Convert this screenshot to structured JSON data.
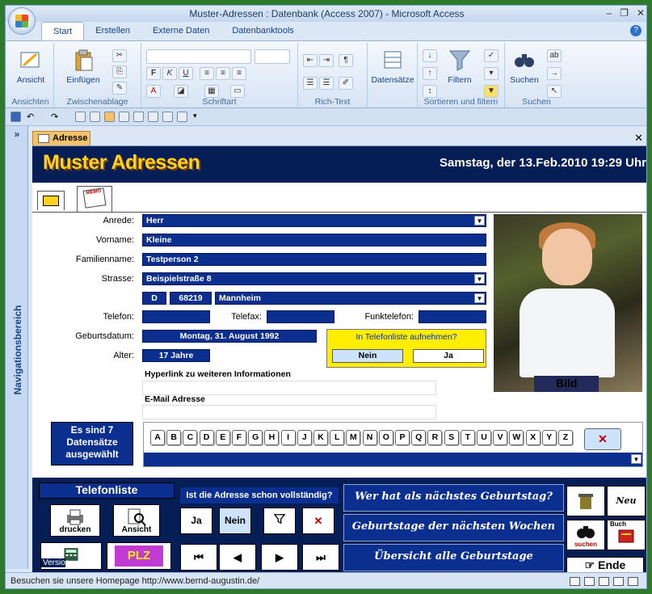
{
  "window": {
    "title": "Muster-Adressen : Datenbank (Access 2007) - Microsoft Access"
  },
  "ribbon": {
    "tabs": [
      "Start",
      "Erstellen",
      "Externe Daten",
      "Datenbanktools"
    ],
    "groups": {
      "ansichten": "Ansichten",
      "zwischenablage": "Zwischenablage",
      "schriftart": "Schriftart",
      "richtext": "Rich-Text",
      "sortieren": "Sortieren und filtern",
      "suchen": "Suchen"
    },
    "buttons": {
      "ansicht": "Ansicht",
      "einfuegen": "Einfügen",
      "datensaetze": "Datensätze",
      "filtern": "Filtern",
      "suchen": "Suchen"
    }
  },
  "nav": {
    "label": "Navigationsbereich"
  },
  "document": {
    "tab": "Adresse"
  },
  "form": {
    "title": "Muster Adressen",
    "datetime": "Samstag, der 13.Feb.2010 19:29 Uhr",
    "labels": {
      "anrede": "Anrede:",
      "vorname": "Vorname:",
      "familienname": "Familienname:",
      "strasse": "Strasse:",
      "telefon": "Telefon:",
      "telefax": "Telefax:",
      "funktelefon": "Funktelefon:",
      "geburtsdatum": "Geburtsdatum:",
      "alter": "Alter:",
      "hyperlink": "Hyperlink zu weiteren Informationen",
      "email": "E-Mail Adresse"
    },
    "values": {
      "anrede": "Herr",
      "vorname": "Kleine",
      "familienname": "Testperson 2",
      "strasse": "Beispielstraße  8",
      "land": "D",
      "plz": "68219",
      "ort": "Mannheim",
      "telefon": "",
      "telefax": "",
      "funktelefon": "",
      "geburtsdatum": "Montag, 31. August 1992",
      "alter": "17 Jahre"
    },
    "photo_label": "Bild",
    "phone_list": {
      "question": "In Telefonliste aufnehmen?",
      "no": "Nein",
      "yes": "Ja"
    },
    "count": {
      "line1": "Es sind  7",
      "line2": "Datensätze",
      "line3": "ausgewählt"
    },
    "letters": [
      "A",
      "B",
      "C",
      "D",
      "E",
      "F",
      "G",
      "H",
      "I",
      "J",
      "K",
      "L",
      "M",
      "N",
      "O",
      "P",
      "Q",
      "R",
      "S",
      "T",
      "U",
      "V",
      "W",
      "X",
      "Y",
      "Z"
    ]
  },
  "footer": {
    "telefonliste": "Telefonliste",
    "drucken": "drucken",
    "ansicht": "Ansicht",
    "plz": "PLZ",
    "question": "Ist die Adresse schon vollständig?",
    "ja": "Ja",
    "nein": "Nein",
    "bday1": "Wer hat als nächstes Geburtstag?",
    "bday2": "Geburtstage der nächsten Wochen",
    "bday3": "Übersicht alle Geburtstage",
    "suchen": "suchen",
    "neu": "Neu",
    "buchen": "Buch",
    "ende": "Ende",
    "version": "Version"
  },
  "status": {
    "text": "Besuchen sie unsere Homepage http://www.bernd-augustin.de/"
  },
  "colors": {
    "form_header": "#051f56",
    "field": "#0b2f8e",
    "title": "#ffd21c",
    "highlight": "#ffee00"
  }
}
